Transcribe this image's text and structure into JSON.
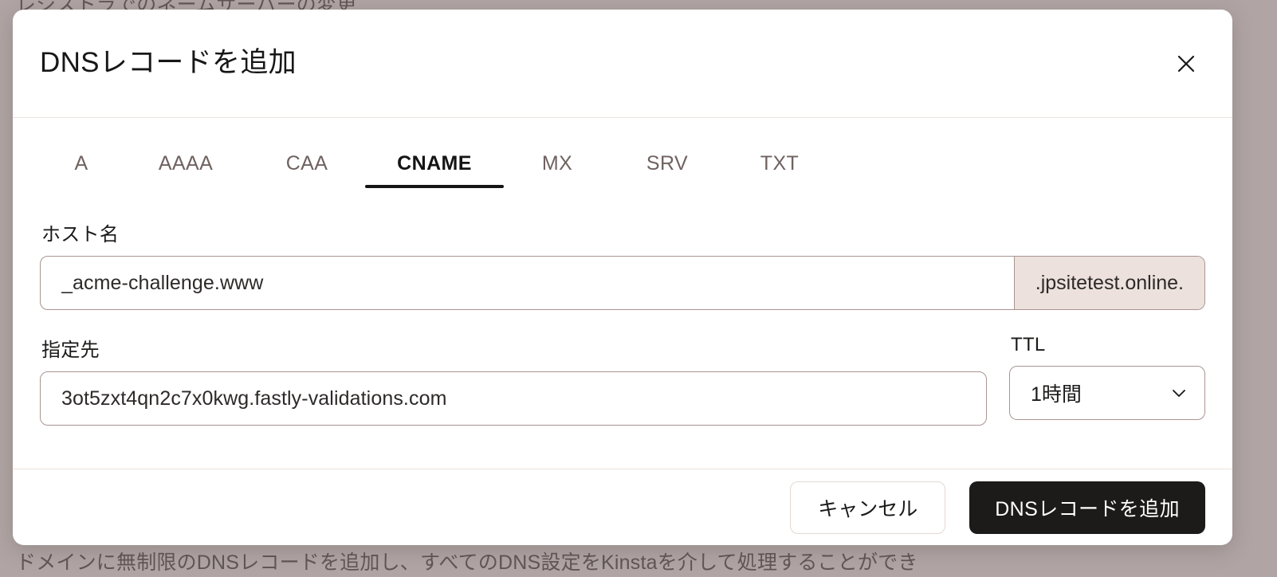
{
  "backdrop": {
    "text_top": "レジストラでのネームサーバーの変更",
    "text_bottom": "ドメインに無制限のDNSレコードを追加し、すべてのDNS設定をKinstaを介して処理することができ"
  },
  "modal": {
    "title": "DNSレコードを追加",
    "close_icon": "close-icon",
    "tabs": [
      {
        "id": "a",
        "label": "A",
        "active": false
      },
      {
        "id": "aaaa",
        "label": "AAAA",
        "active": false
      },
      {
        "id": "caa",
        "label": "CAA",
        "active": false
      },
      {
        "id": "cname",
        "label": "CNAME",
        "active": true
      },
      {
        "id": "mx",
        "label": "MX",
        "active": false
      },
      {
        "id": "srv",
        "label": "SRV",
        "active": false
      },
      {
        "id": "txt",
        "label": "TXT",
        "active": false
      }
    ],
    "hostname": {
      "label": "ホスト名",
      "value": "_acme-challenge.www",
      "placeholder": "ホスト名",
      "suffix": ".jpsitetest.online."
    },
    "destination": {
      "label": "指定先",
      "value": "3ot5zxt4qn2c7x0kwg.fastly-validations.com",
      "placeholder": "指定先"
    },
    "ttl": {
      "label": "TTL",
      "value": "1時間",
      "chevron_icon": "chevron-down-icon",
      "options": [
        "1時間"
      ]
    },
    "footer": {
      "cancel_label": "キャンセル",
      "submit_label": "DNSレコードを追加"
    }
  },
  "colors": {
    "backdrop": "#b0a5a4",
    "surface": "#ffffff",
    "accent_dark": "#1c1b1a",
    "input_border": "#a99592",
    "suffix_bg": "#ece1dc",
    "divider": "#ece2dd"
  }
}
